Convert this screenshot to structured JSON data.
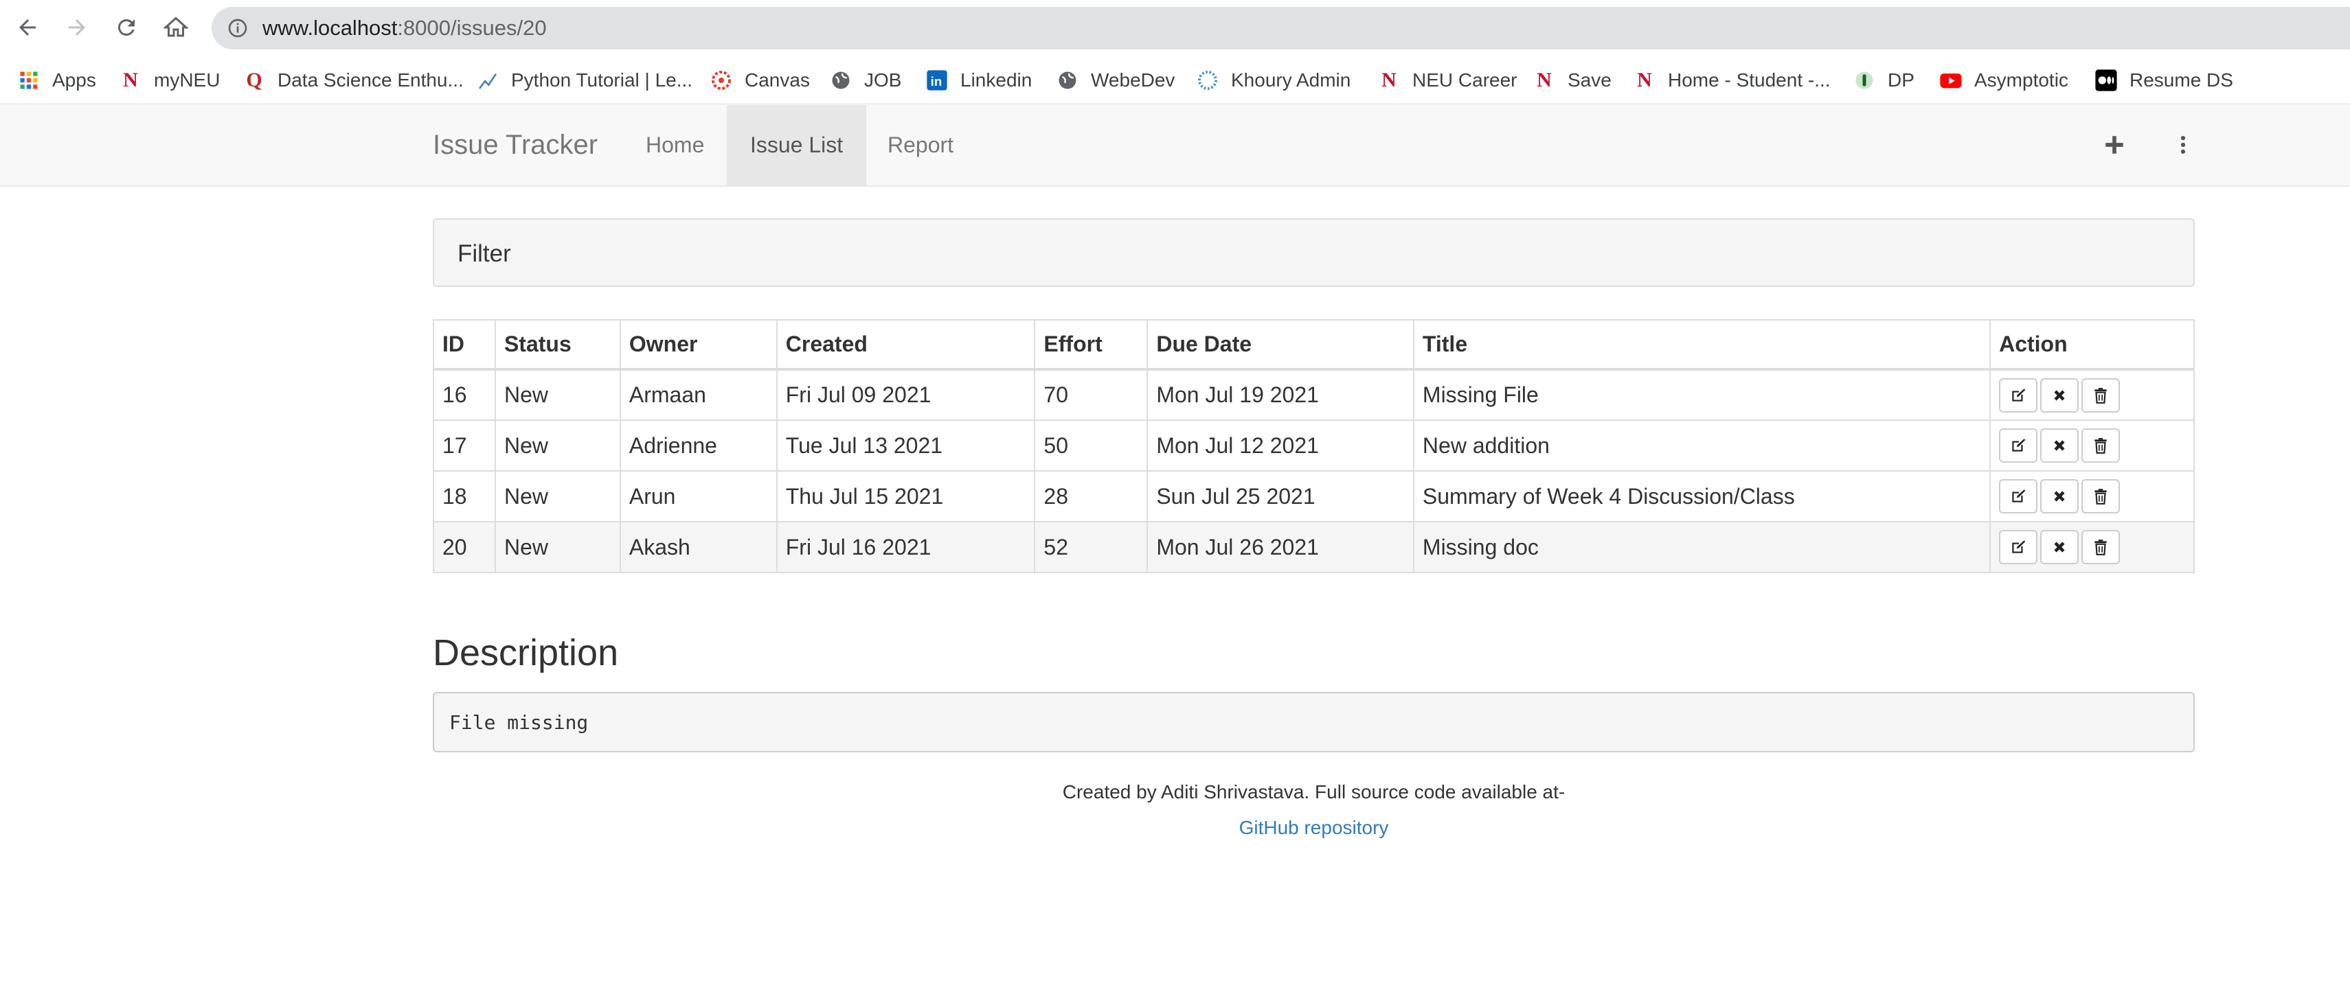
{
  "browser": {
    "url_host": "www.localhost",
    "url_path": ":8000/issues/20",
    "bookmarks": [
      {
        "label": "Apps",
        "icon": "apps-grid-icon"
      },
      {
        "label": "myNEU",
        "icon": "neu-icon"
      },
      {
        "label": "Data Science Enthu...",
        "icon": "quora-icon"
      },
      {
        "label": "Python Tutorial | Le...",
        "icon": "chart-icon"
      },
      {
        "label": "Canvas",
        "icon": "canvas-icon"
      },
      {
        "label": "JOB",
        "icon": "globe-icon"
      },
      {
        "label": "Linkedin",
        "icon": "linkedin-icon"
      },
      {
        "label": "WebeDev",
        "icon": "globe-icon"
      },
      {
        "label": "Khoury Admin",
        "icon": "khoury-icon"
      },
      {
        "label": "NEU Career",
        "icon": "neu-icon"
      },
      {
        "label": "Save",
        "icon": "neu-icon"
      },
      {
        "label": "Home - Student -...",
        "icon": "neu-icon"
      },
      {
        "label": "DP",
        "icon": "dp-icon"
      },
      {
        "label": "Asymptotic",
        "icon": "youtube-icon"
      },
      {
        "label": "Resume DS",
        "icon": "medium-icon"
      }
    ]
  },
  "navbar": {
    "brand": "Issue Tracker",
    "items": [
      {
        "label": "Home",
        "active": false
      },
      {
        "label": "Issue List",
        "active": true
      },
      {
        "label": "Report",
        "active": false
      }
    ]
  },
  "filter": {
    "title": "Filter"
  },
  "table": {
    "headers": [
      "ID",
      "Status",
      "Owner",
      "Created",
      "Effort",
      "Due Date",
      "Title",
      "Action"
    ],
    "rows": [
      {
        "id": "16",
        "status": "New",
        "owner": "Armaan",
        "created": "Fri Jul 09 2021",
        "effort": "70",
        "due": "Mon Jul 19 2021",
        "title": "Missing File"
      },
      {
        "id": "17",
        "status": "New",
        "owner": "Adrienne",
        "created": "Tue Jul 13 2021",
        "effort": "50",
        "due": "Mon Jul 12 2021",
        "title": "New addition"
      },
      {
        "id": "18",
        "status": "New",
        "owner": "Arun",
        "created": "Thu Jul 15 2021",
        "effort": "28",
        "due": "Sun Jul 25 2021",
        "title": "Summary of Week 4 Discussion/Class"
      },
      {
        "id": "20",
        "status": "New",
        "owner": "Akash",
        "created": "Fri Jul 16 2021",
        "effort": "52",
        "due": "Mon Jul 26 2021",
        "title": "Missing doc"
      }
    ]
  },
  "description": {
    "heading": "Description",
    "text": "File missing"
  },
  "footer": {
    "text": "Created by Aditi Shrivastava. Full source code available at-",
    "link": "GitHub repository"
  },
  "colors": {
    "navbar_bg": "#f8f8f8",
    "active_tab_bg": "#e7e7e7",
    "link": "#337ab7",
    "selected_row_bg": "#f5f5f5"
  }
}
